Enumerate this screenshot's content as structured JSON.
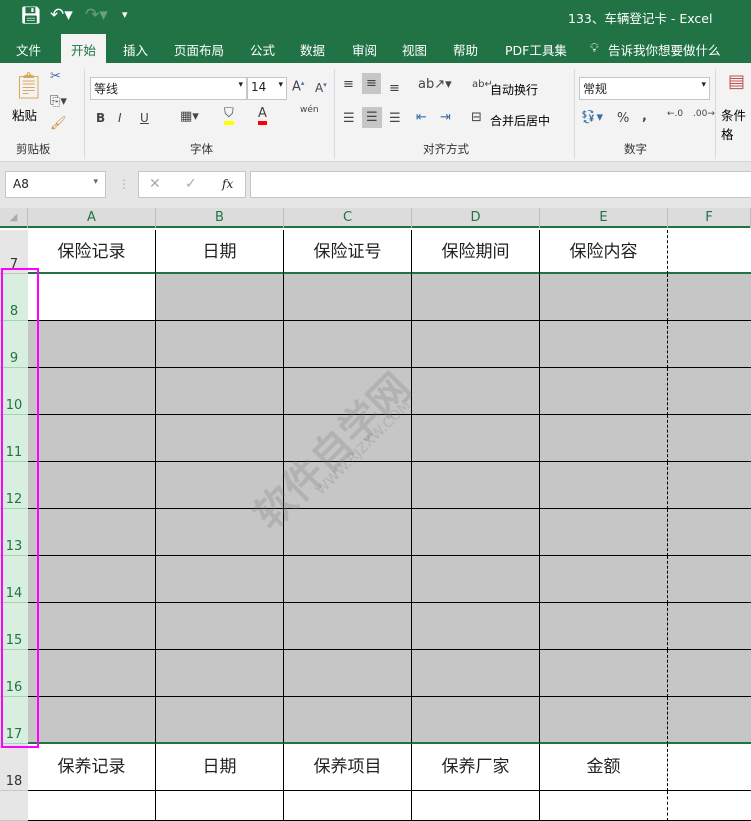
{
  "title_bar": {
    "title": "133、车辆登记卡  -  Excel"
  },
  "tabs": [
    "文件",
    "开始",
    "插入",
    "页面布局",
    "公式",
    "数据",
    "审阅",
    "视图",
    "帮助",
    "PDF工具集"
  ],
  "tell_me": "告诉我你想要做什么",
  "ribbon": {
    "clipboard": {
      "paste": "粘贴",
      "group": "剪贴板"
    },
    "font": {
      "name": "等线",
      "size": "14",
      "bold": "B",
      "italic": "I",
      "underline": "U",
      "phonetic": "wén",
      "group": "字体",
      "highlight_color": "#ffff00",
      "font_color": "#ff0000"
    },
    "alignment": {
      "wrap": "自动换行",
      "merge": "合并后居中",
      "group": "对齐方式"
    },
    "number": {
      "format": "常规",
      "percent": "%",
      "comma": ",",
      "group": "数字"
    },
    "styles": {
      "conditional": "条件格"
    }
  },
  "formula_bar": {
    "name_box": "A8",
    "fx": "fx",
    "value": ""
  },
  "columns": [
    "A",
    "B",
    "C",
    "D",
    "E",
    "F"
  ],
  "rows": [
    {
      "n": "7",
      "cells": [
        "保险记录",
        "日期",
        "保险证号",
        "保险期间",
        "保险内容",
        ""
      ]
    },
    {
      "n": "8",
      "cells": [
        "",
        "",
        "",
        "",
        "",
        ""
      ]
    },
    {
      "n": "9",
      "cells": [
        "",
        "",
        "",
        "",
        "",
        ""
      ]
    },
    {
      "n": "10",
      "cells": [
        "",
        "",
        "",
        "",
        "",
        ""
      ]
    },
    {
      "n": "11",
      "cells": [
        "",
        "",
        "",
        "",
        "",
        ""
      ]
    },
    {
      "n": "12",
      "cells": [
        "",
        "",
        "",
        "",
        "",
        ""
      ]
    },
    {
      "n": "13",
      "cells": [
        "",
        "",
        "",
        "",
        "",
        ""
      ]
    },
    {
      "n": "14",
      "cells": [
        "",
        "",
        "",
        "",
        "",
        ""
      ]
    },
    {
      "n": "15",
      "cells": [
        "",
        "",
        "",
        "",
        "",
        ""
      ]
    },
    {
      "n": "16",
      "cells": [
        "",
        "",
        "",
        "",
        "",
        ""
      ]
    },
    {
      "n": "17",
      "cells": [
        "",
        "",
        "",
        "",
        "",
        ""
      ]
    },
    {
      "n": "18",
      "cells": [
        "保养记录",
        "日期",
        "保养项目",
        "保养厂家",
        "金额",
        ""
      ]
    },
    {
      "n": "",
      "cells": [
        "",
        "",
        "",
        "",
        "",
        ""
      ]
    }
  ],
  "watermark": "软件自学网",
  "watermark_url": "WWW.RJZXW.COM",
  "colors": {
    "excel_green": "#217346",
    "selected_fill": "#c6c6c6",
    "highlight_box": "#ff00ff"
  }
}
